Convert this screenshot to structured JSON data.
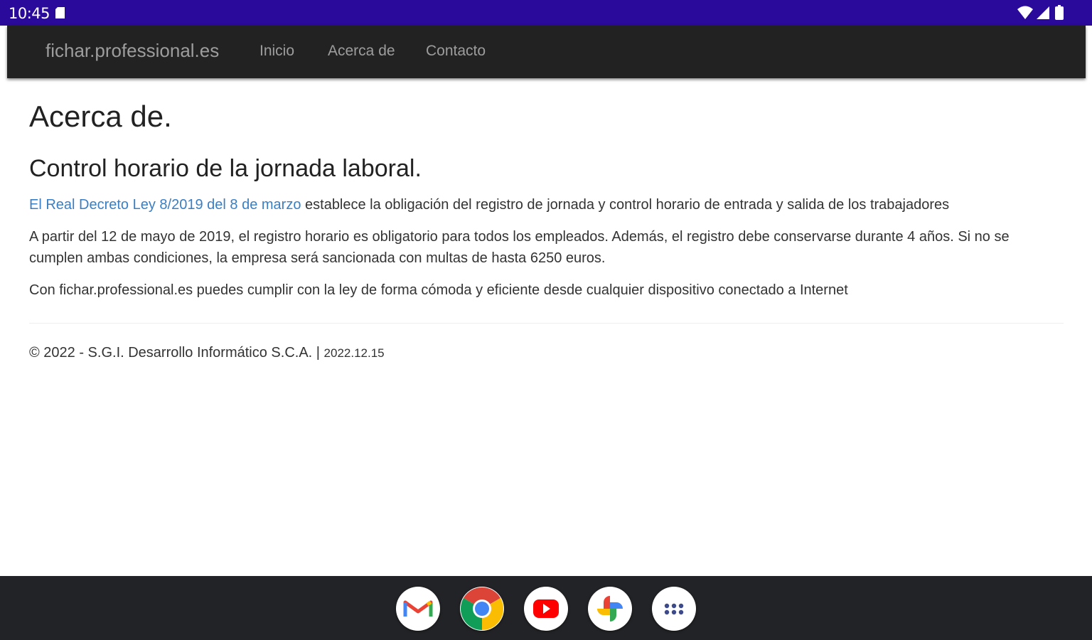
{
  "status_bar": {
    "time": "10:45",
    "icons": [
      "sd-card-icon",
      "wifi-icon",
      "cell-signal-icon",
      "battery-icon"
    ]
  },
  "navbar": {
    "brand": "fichar.professional.es",
    "links": [
      "Inicio",
      "Acerca de",
      "Contacto"
    ]
  },
  "page": {
    "title": "Acerca de.",
    "subtitle": "Control horario de la jornada laboral.",
    "para1_link": "El Real Decreto Ley 8/2019 del 8 de marzo",
    "para1_rest": " establece la obligación del registro de jornada y control horario de entrada y salida de los trabajadores",
    "para2": "A partir del 12 de mayo de 2019, el registro horario es obligatorio para todos los empleados. Además, el registro debe conservarse durante 4 años. Si no se cumplen ambas condiciones, la empresa será sancionada con multas de hasta 6250 euros.",
    "para3": "Con fichar.professional.es puedes cumplir con la ley de forma cómoda y eficiente desde cualquier dispositivo conectado a Internet"
  },
  "footer": {
    "copyright": "© 2022 - S.G.I. Desarrollo Informático S.C.A. | ",
    "version": "2022.12.15"
  },
  "taskbar": {
    "apps": [
      "gmail-icon",
      "chrome-icon",
      "youtube-icon",
      "photos-icon",
      "app-drawer-icon"
    ]
  },
  "colors": {
    "status_bar": "#2a0a9a",
    "navbar": "#222222",
    "nav_text": "#9d9d9d",
    "link": "#3a7fc4",
    "taskbar": "#222326"
  }
}
